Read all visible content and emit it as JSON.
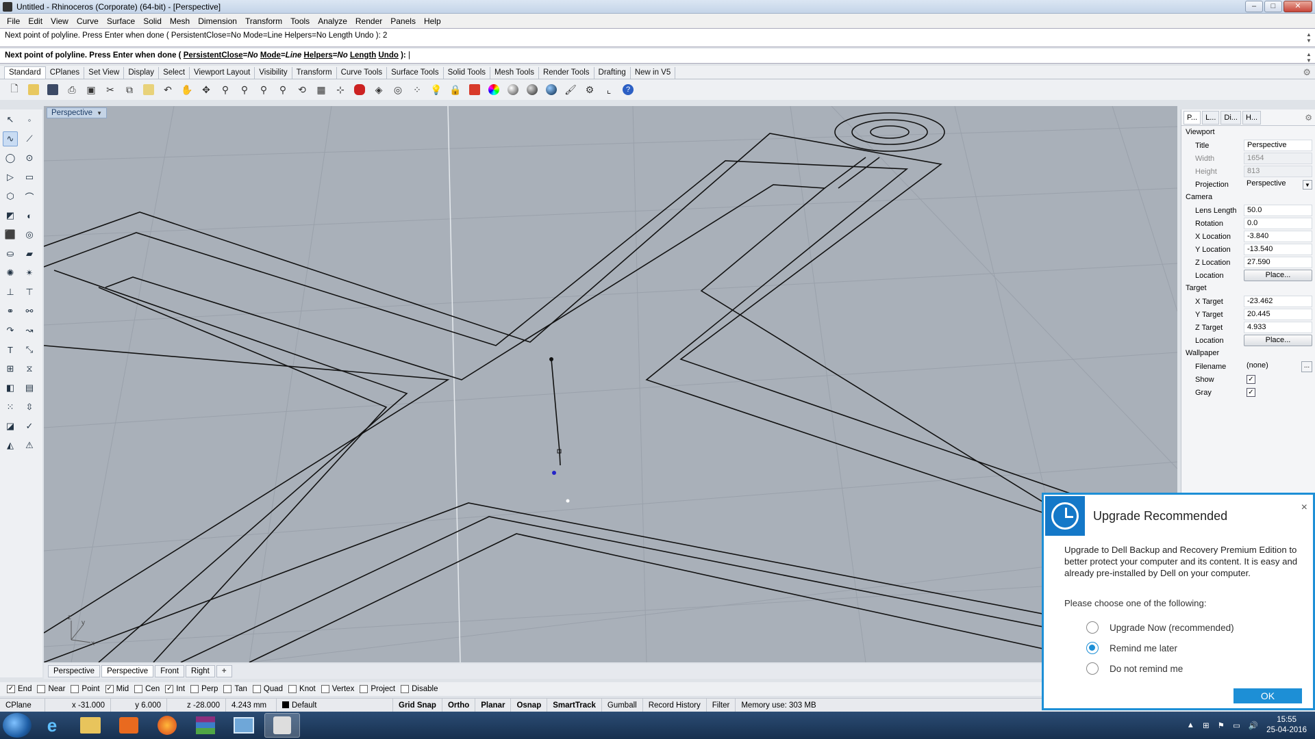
{
  "window": {
    "title": "Untitled - Rhinoceros (Corporate) (64-bit) - [Perspective]",
    "min_glyph": "–",
    "max_glyph": "□",
    "close_glyph": "✕"
  },
  "menu": [
    "File",
    "Edit",
    "View",
    "Curve",
    "Surface",
    "Solid",
    "Mesh",
    "Dimension",
    "Transform",
    "Tools",
    "Analyze",
    "Render",
    "Panels",
    "Help"
  ],
  "command": {
    "history": "Next point of polyline. Press Enter when done ( PersistentClose=No  Mode=Line  Helpers=No  Length  Undo ): 2",
    "prompt": "Next point of polyline. Press Enter when done (",
    "opt1": "PersistentClose",
    "opt1_val": "No",
    "opt2": "Mode",
    "opt2_val": "Line",
    "opt3": "Helpers",
    "opt3_val": "No",
    "opt4": "Length",
    "opt5": "Undo",
    "tail": "):"
  },
  "toolbar_tabs": [
    "Standard",
    "CPlanes",
    "Set View",
    "Display",
    "Select",
    "Viewport Layout",
    "Visibility",
    "Transform",
    "Curve Tools",
    "Surface Tools",
    "Solid Tools",
    "Mesh Tools",
    "Render Tools",
    "Drafting",
    "New in V5"
  ],
  "viewport": {
    "title": "Perspective",
    "axis_z": "z",
    "axis_y": "y",
    "axis_x": "x"
  },
  "viewport_tabs": [
    "Perspective",
    "Perspective",
    "Front",
    "Right"
  ],
  "viewport_tab_add": "+",
  "panel": {
    "tabs": [
      "P...",
      "L...",
      "Di...",
      "H..."
    ],
    "viewport_section": "Viewport",
    "title_label": "Title",
    "title_value": "Perspective",
    "width_label": "Width",
    "width_value": "1654",
    "height_label": "Height",
    "height_value": "813",
    "projection_label": "Projection",
    "projection_value": "Perspective",
    "camera_section": "Camera",
    "lens_label": "Lens Length",
    "lens_value": "50.0",
    "rotation_label": "Rotation",
    "rotation_value": "0.0",
    "xloc_label": "X Location",
    "xloc_value": "-3.840",
    "yloc_label": "Y Location",
    "yloc_value": "-13.540",
    "zloc_label": "Z Location",
    "zloc_value": "27.590",
    "location_label": "Location",
    "place_label": "Place...",
    "target_section": "Target",
    "xt_label": "X Target",
    "xt_value": "-23.462",
    "yt_label": "Y Target",
    "yt_value": "20.445",
    "zt_label": "Z Target",
    "zt_value": "4.933",
    "wallpaper_section": "Wallpaper",
    "filename_label": "Filename",
    "filename_value": "(none)",
    "dots": "...",
    "show_label": "Show",
    "gray_label": "Gray",
    "check": "✓"
  },
  "osnap": [
    {
      "label": "End",
      "checked": true
    },
    {
      "label": "Near",
      "checked": false
    },
    {
      "label": "Point",
      "checked": false
    },
    {
      "label": "Mid",
      "checked": true
    },
    {
      "label": "Cen",
      "checked": false
    },
    {
      "label": "Int",
      "checked": true
    },
    {
      "label": "Perp",
      "checked": false
    },
    {
      "label": "Tan",
      "checked": false
    },
    {
      "label": "Quad",
      "checked": false
    },
    {
      "label": "Knot",
      "checked": false
    },
    {
      "label": "Vertex",
      "checked": false
    },
    {
      "label": "Project",
      "checked": false
    },
    {
      "label": "Disable",
      "checked": false
    }
  ],
  "status": {
    "cplane": "CPlane",
    "x": "x -31.000",
    "y": "y 6.000",
    "z": "z -28.000",
    "dist": "4.243 mm",
    "layer": "Default",
    "grid_snap": "Grid Snap",
    "ortho": "Ortho",
    "planar": "Planar",
    "osnap": "Osnap",
    "smarttrack": "SmartTrack",
    "gumball": "Gumball",
    "record_history": "Record History",
    "filter": "Filter",
    "memory": "Memory use: 303 MB"
  },
  "popup": {
    "title": "Upgrade Recommended",
    "close": "×",
    "body": "Upgrade to Dell Backup and Recovery Premium Edition to better protect your computer and its content. It is easy and already pre-installed by Dell on your computer.",
    "ask": "Please choose one of the following:",
    "options": [
      {
        "label": "Upgrade Now (recommended)",
        "selected": false
      },
      {
        "label": "Remind me later",
        "selected": true
      },
      {
        "label": "Do not remind me",
        "selected": false
      }
    ],
    "ok": "OK"
  },
  "clock": {
    "time": "15:55",
    "date": "25-04-2016"
  },
  "colors": {
    "viewport_bg": "#a9b0b9",
    "popup_accent": "#1d8fd6"
  }
}
